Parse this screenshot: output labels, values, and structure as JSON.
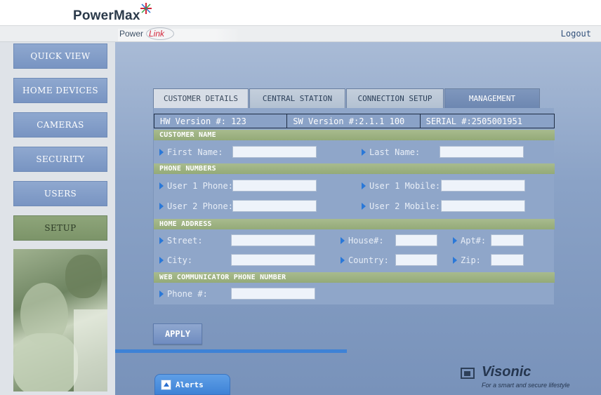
{
  "header": {
    "brand": "PowerMax",
    "sublogo_power": "Power",
    "sublogo_link": "Link",
    "logout_label": "Logout"
  },
  "sidebar": {
    "items": [
      {
        "label": "QUICK VIEW"
      },
      {
        "label": "HOME DEVICES"
      },
      {
        "label": "CAMERAS"
      },
      {
        "label": "SECURITY"
      },
      {
        "label": "USERS"
      },
      {
        "label": "SETUP",
        "active": true
      }
    ]
  },
  "tabs": [
    {
      "label": "CUSTOMER DETAILS",
      "active": true
    },
    {
      "label": "CENTRAL STATION"
    },
    {
      "label": "CONNECTION SETUP"
    },
    {
      "label": "MANAGEMENT"
    }
  ],
  "versions": {
    "hw": "HW Version #: 123",
    "sw": "SW Version #:2.1.1 100",
    "serial": "SERIAL #:2505001951"
  },
  "sections": {
    "customer_name": "CUSTOMER NAME",
    "phone_numbers": "PHONE NUMBERS",
    "home_address": "HOME ADDRESS",
    "web_communicator": "WEB COMMUNICATOR PHONE NUMBER"
  },
  "fields": {
    "first_name": {
      "label": "First Name:",
      "value": ""
    },
    "last_name": {
      "label": "Last Name:",
      "value": ""
    },
    "user1_phone": {
      "label": "User 1 Phone:",
      "value": ""
    },
    "user1_mobile": {
      "label": "User 1 Mobile:",
      "value": ""
    },
    "user2_phone": {
      "label": "User 2 Phone:",
      "value": ""
    },
    "user2_mobile": {
      "label": "User 2 Mobile:",
      "value": ""
    },
    "street": {
      "label": "Street:",
      "value": ""
    },
    "house": {
      "label": "House#:",
      "value": ""
    },
    "apt": {
      "label": "Apt#:",
      "value": ""
    },
    "city": {
      "label": "City:",
      "value": ""
    },
    "country": {
      "label": "Country:",
      "value": ""
    },
    "zip": {
      "label": "Zip:",
      "value": ""
    },
    "phone": {
      "label": "Phone #:",
      "value": ""
    }
  },
  "actions": {
    "apply_label": "APPLY"
  },
  "alerts": {
    "label": "Alerts"
  },
  "footer": {
    "brand": "Visonic",
    "tagline": "For a smart and secure lifestyle"
  },
  "colors": {
    "accent_blue": "#2a78d8",
    "section_green": "#94aa78",
    "nav_blue": "#7894c2",
    "nav_active_green": "#7c9469"
  }
}
